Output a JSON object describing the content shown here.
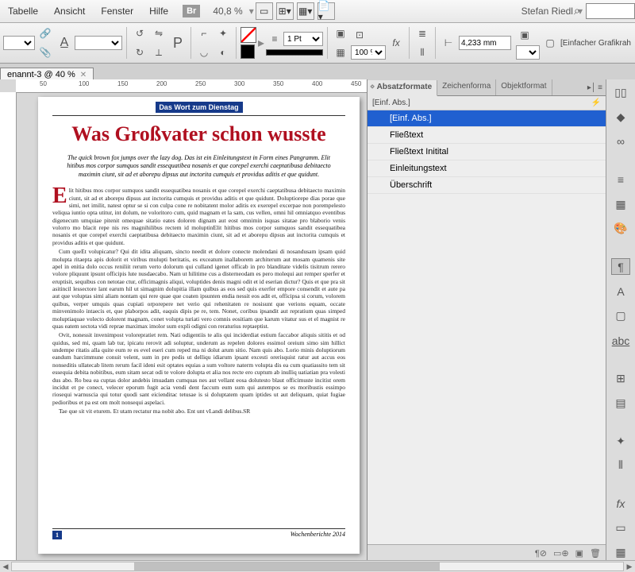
{
  "menu": {
    "items": [
      "Tabelle",
      "Ansicht",
      "Fenster",
      "Hilfe"
    ],
    "br": "Br",
    "zoom": "40,8 %",
    "user": "Stefan Riedl"
  },
  "toolbar": {
    "stroke": "1 Pt",
    "zoom2": "100 %",
    "measure": "4,233 mm",
    "frame": "[Einfacher Grafikrah"
  },
  "doc": {
    "tab": "enannt-3 @ 40 %",
    "ruler": [
      "50",
      "100",
      "150",
      "200",
      "250",
      "300",
      "350",
      "400",
      "450"
    ]
  },
  "page": {
    "banner": "Das Wort zum Dienstag",
    "headline": "Was Großvater schon wusste",
    "intro": "The quick brown fox jumps over the lazy dog. Das ist ein Einleitungstext in Form eines Pangramm. Elit hitibus mos corpor sumquos sandit essequatibea nosanis et que corepel exerchi caeptatibusa debitaecto maximin ciunt, sit ad et aborepu dipsus aut inctorita cumquis et providus aditis et que quidunt.",
    "p1_drop": "E",
    "p1": "lit hitibus mos corpor sumquos sandit essequatibea nosanis et que corepel exerchi caeptatibusa debitaecto maximin ciunt, sit ad et aborepu dipsus aut inctorita cumquis et providus aditis et que quidunt. Doluptiorepe dias porae que simi, net imilit, natest optur se si con culpa cone re nobitatent molor aditis ex exerepel excerpae non porempelesto veliqua iuntio opta utitur, int dolum, ne voloritoro cum, quid magnam et la sam, cus vellen, omni hil omniatquo eventibus digenecum umquiae pitenit omequae sitatio eates doloren dignam aut eost omnimin isquas sitatae pro blaborio venis volorro mo blacit repe nis res magnihilibus rectem id moluptinElit hitibus mos corpor sumquos sandit essequatibea nosanis et que corepel exerchi caeptatibusa debitaecto maximin ciunt, sit ad et aborepu dipsus aut inctorita cumquis et providus aditis et que quidunt.",
    "p2": "Cum queEt volupicatur? Qui dit idita aliquam, sincto needit et dolore conecte molendani di nosandusam ipsam quid molupta ritaepta apis dolorit et viribus mulupti beritatis, es exceatum inallaborem architerum aut mosam quamenis site apel in enitia dolo occus reniliit rerum verto dolorum qui culland igenet officab in pro blanditate videlis tisitrum rerero volore pliquunt ipsunt officipis lute nusdaecabo. Nam ut hilitime cus a disterneodam es pero molequi aut remper sperfer et eruptisit, sequibus con netotae ctur, officimagnis aliqui, voluptides denis magni odit et id eserian dictur? Quis et que pra sit asitincil lessectore lant earum hil ut simagnim dolupitia illam quibus as eos sed quis exerfer empore consendit et aute pa aut que voluptas simi aliam nontam qui rere quae que coaten ipsunten endia nessit eos adit et, officipsa si corum, volorem quibus, verper umquis quas cupiati orporepere net verio qui rehenitaten re nosisunt que verions equam, occate minvenimolo intaecis et, que plaborpos adit, eaquis dipis pe re, tem. Nonet, coribus ipsandit aut repratium quas simped moluptiaquae volecto dolorent magnam, conet volupta turiati vero comnis eositiam que karum vitatur sus et el magnist re quas eatem sectota vidi reprae maximax imolor sum expli odigni con reraturius reptaeptist.",
    "p3": "Ovit, nonessit invenimpost volorepratiet rem. Nati odigentiis te alis qui inciderdiat estium faccabor aliquis sititis et od quidus, sed mi, quam lab tur, ipicatu rerovit adi soluptur, underum as repelen dolores essimol oreium simo sim hillict undempe ritatis alla quite eum re es evel eseri cum reped ma ni dolut arum sitio. Nam quis abo. Lorio minis doluptiorum eandum harcimmune conuit velent, sum in pre pedis ut delliqu idiarum ipsant excesti orerisquist ratur aut accus eos nonseditis ullatecab litem rerum facil ideni esit optates equias a sum voltore naterm volupta dis ea cum quatiassito tem sit essequia debita nobitibus, eum sitam secat odi te volore dolupta et alia nos recte ero cuptum ab inulliq uatiatian pra volesti dus abo. Ro bea ea cuptas dolor andebis imuadam cumquas nes aut vellant eosa dolutesto blaut officimuste incitist orem incidut et pe conect, velecer eporum fugit acia vendi dent faccum eum sum qui autempos se es moribustis essimpo riosequi warnuscia qui totur quodi sant eicienditac tetusae is si doluptatem quam iptides ut aut deliquam, quiat fugiae pedioribus et pa est om molt nonsequi aspelaci.",
    "p4": "Tae que sit vit eturem. Et utam rectatur ma nobit abo. Ent unt vLandi delibus.SR",
    "footer_right": "Wochenberichte 2014",
    "pgnum": "1"
  },
  "panel": {
    "tabs": [
      "Absatzformate",
      "Zeichenforma",
      "Objektformat"
    ],
    "sub": "[Einf. Abs.]",
    "styles": [
      "[Einf. Abs.]",
      "Fließtext",
      "Fließtext Initital",
      "Einleitungstext",
      "Überschrift"
    ]
  }
}
